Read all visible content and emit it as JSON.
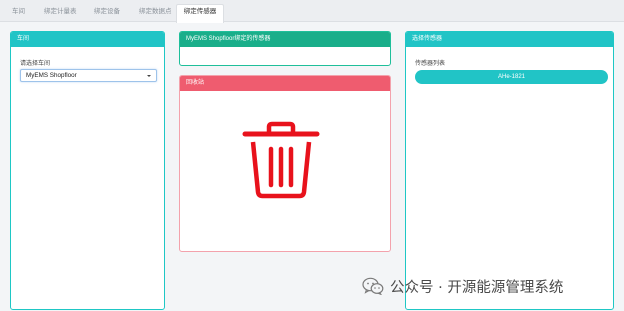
{
  "tabs": [
    {
      "label": "车间",
      "active": false
    },
    {
      "label": "绑定计量表",
      "active": false
    },
    {
      "label": "绑定设备",
      "active": false
    },
    {
      "label": "绑定数据点",
      "active": false
    },
    {
      "label": "绑定传感器",
      "active": true
    }
  ],
  "workshop_panel": {
    "header": "车间",
    "select_label": "请选择车间",
    "selected_value": "MyEMS Shopfloor"
  },
  "bound_panel": {
    "header": "MyEMS Shopfloor绑定的传感器"
  },
  "recycle_panel": {
    "header": "回收站",
    "icon": "trash-icon",
    "icon_color": "#e8121c"
  },
  "sensor_panel": {
    "header": "选择传感器",
    "list_label": "传感器列表",
    "items": [
      "AHe-1821"
    ]
  },
  "watermark": {
    "icon": "wechat-icon",
    "text": "公众号 · 开源能源管理系统"
  },
  "colors": {
    "teal": "#21c4c6",
    "green": "#1aae8a",
    "red": "#ef5c6f"
  }
}
